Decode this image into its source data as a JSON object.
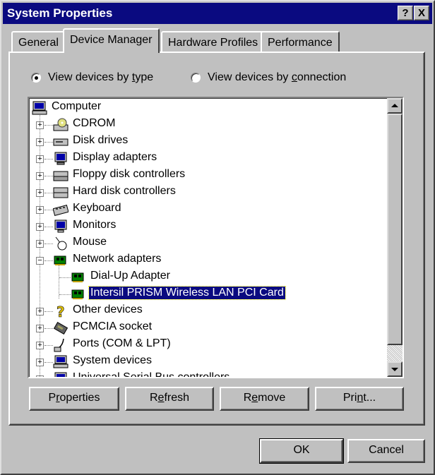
{
  "window": {
    "title": "System Properties",
    "help_btn": "?",
    "close_btn": "X"
  },
  "tabs": [
    {
      "label": "General"
    },
    {
      "label": "Device Manager",
      "active": true
    },
    {
      "label": "Hardware Profiles"
    },
    {
      "label": "Performance"
    }
  ],
  "view_options": {
    "by_type": {
      "pre": "View devices by ",
      "u": "t",
      "post": "ype",
      "selected": true
    },
    "by_connection": {
      "pre": "View devices by ",
      "u": "c",
      "post": "onnection",
      "selected": false
    }
  },
  "tree": {
    "root": "Computer",
    "categories": [
      {
        "label": "CDROM",
        "icon": "cdrom-icon"
      },
      {
        "label": "Disk drives",
        "icon": "disk-drive-icon"
      },
      {
        "label": "Display adapters",
        "icon": "display-adapter-icon"
      },
      {
        "label": "Floppy disk controllers",
        "icon": "floppy-controller-icon"
      },
      {
        "label": "Hard disk controllers",
        "icon": "hard-disk-controller-icon"
      },
      {
        "label": "Keyboard",
        "icon": "keyboard-icon"
      },
      {
        "label": "Monitors",
        "icon": "monitor-icon"
      },
      {
        "label": "Mouse",
        "icon": "mouse-icon"
      },
      {
        "label": "Network adapters",
        "icon": "network-adapter-icon",
        "expanded": true
      },
      {
        "label": "Dial-Up Adapter",
        "icon": "network-card-icon",
        "child": true
      },
      {
        "label": "Intersil PRISM Wireless LAN PCI Card",
        "icon": "network-card-icon",
        "child": true,
        "selected": true
      },
      {
        "label": "Other devices",
        "icon": "question-mark-icon"
      },
      {
        "label": "PCMCIA socket",
        "icon": "pcmcia-icon"
      },
      {
        "label": "Ports (COM & LPT)",
        "icon": "port-icon"
      },
      {
        "label": "System devices",
        "icon": "system-devices-icon"
      },
      {
        "label": "Universal Serial Bus controllers",
        "icon": "usb-icon"
      }
    ]
  },
  "buttons": {
    "properties": {
      "pre": "P",
      "u": "r",
      "post": "operties"
    },
    "refresh": {
      "pre": "R",
      "u": "e",
      "post": "fresh"
    },
    "remove": {
      "pre": "R",
      "u": "e",
      "post": "move"
    },
    "print": {
      "pre": "Pri",
      "u": "n",
      "post": "t..."
    },
    "ok": "OK",
    "cancel": "Cancel"
  },
  "colors": {
    "titlebar": "#0a0a80",
    "face": "#c0c0c0",
    "selection": "#0a0a80"
  }
}
